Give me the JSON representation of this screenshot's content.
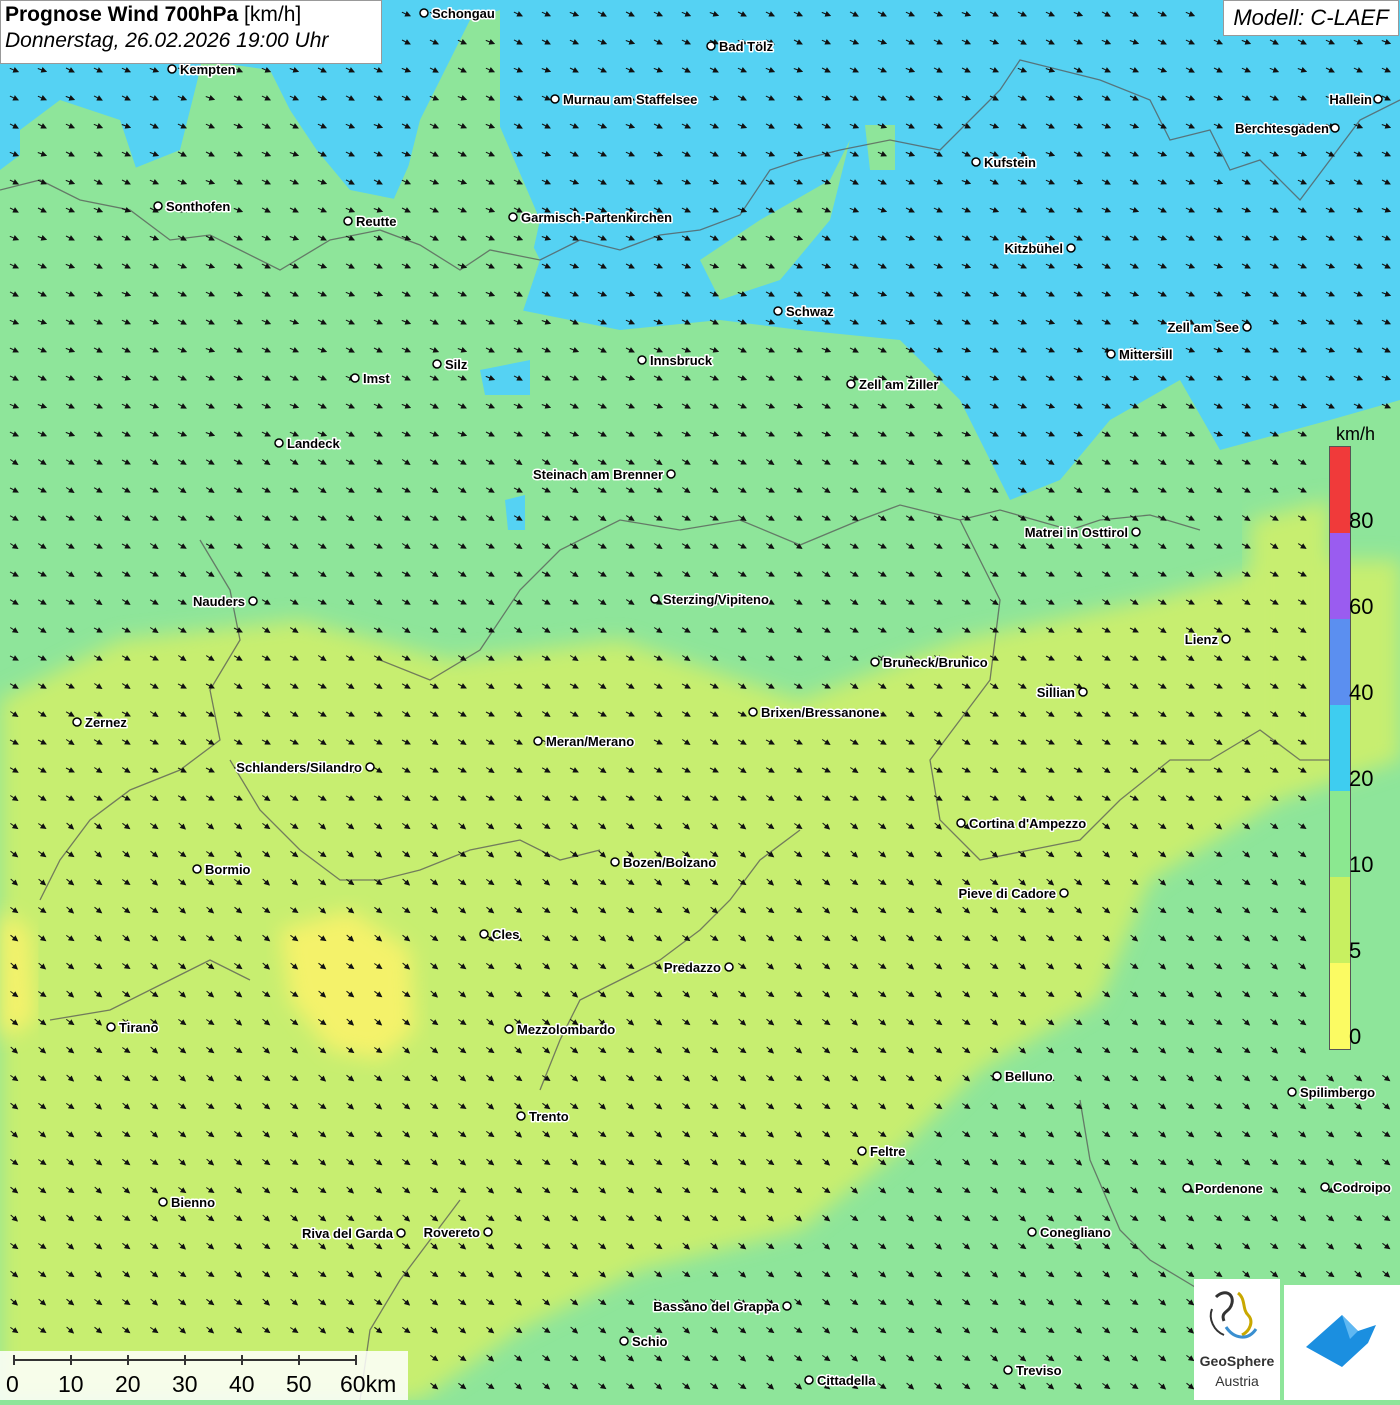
{
  "header": {
    "title_bold": "Prognose Wind 700hPa",
    "title_unit": "[km/h]",
    "date": "Donnerstag, 26.02.2026 19:00 Uhr"
  },
  "model": "Modell: C-LAEF",
  "legend": {
    "unit": "km/h",
    "labels": [
      "0",
      "5",
      "10",
      "20",
      "40",
      "60",
      "80"
    ],
    "colors": [
      "#fbfb63",
      "#c8f060",
      "#8be890",
      "#3ecdf0",
      "#5b8ff0",
      "#9a5cf0",
      "#f03a3a"
    ]
  },
  "scale": {
    "labels": [
      "0",
      "10",
      "20",
      "30",
      "40",
      "50",
      "60km"
    ]
  },
  "logos": {
    "geosphere_line1": "GeoSphere",
    "geosphere_line2": "Austria"
  },
  "cities": [
    {
      "name": "Schongau"
    },
    {
      "name": "Bad Tölz"
    },
    {
      "name": "Kempten"
    },
    {
      "name": "Murnau am Staffelsee"
    },
    {
      "name": "Hallein"
    },
    {
      "name": "Berchtesgaden"
    },
    {
      "name": "Kufstein"
    },
    {
      "name": "Sonthofen"
    },
    {
      "name": "Reutte"
    },
    {
      "name": "Garmisch-Partenkirchen"
    },
    {
      "name": "Kitzbühel"
    },
    {
      "name": "Schwaz"
    },
    {
      "name": "Zell am See"
    },
    {
      "name": "Mittersill"
    },
    {
      "name": "Innsbruck"
    },
    {
      "name": "Silz"
    },
    {
      "name": "Imst"
    },
    {
      "name": "Zell am Ziller"
    },
    {
      "name": "Landeck"
    },
    {
      "name": "Steinach am Brenner"
    },
    {
      "name": "Matrei in Osttirol"
    },
    {
      "name": "Nauders"
    },
    {
      "name": "Sterzing/Vipiteno"
    },
    {
      "name": "Lienz"
    },
    {
      "name": "Bruneck/Brunico"
    },
    {
      "name": "Sillian"
    },
    {
      "name": "Brixen/Bressanone"
    },
    {
      "name": "Zernez"
    },
    {
      "name": "Meran/Merano"
    },
    {
      "name": "Schlanders/Silandro"
    },
    {
      "name": "Cortina d'Ampezzo"
    },
    {
      "name": "Bozen/Bolzano"
    },
    {
      "name": "Bormio"
    },
    {
      "name": "Pieve di Cadore"
    },
    {
      "name": "Cles"
    },
    {
      "name": "Predazzo"
    },
    {
      "name": "Tirano"
    },
    {
      "name": "Mezzolombardo"
    },
    {
      "name": "Belluno"
    },
    {
      "name": "Spilimbergo"
    },
    {
      "name": "Trento"
    },
    {
      "name": "Feltre"
    },
    {
      "name": "Pordenone"
    },
    {
      "name": "Codroipo"
    },
    {
      "name": "Bienno"
    },
    {
      "name": "Riva del Garda"
    },
    {
      "name": "Rovereto"
    },
    {
      "name": "Conegliano"
    },
    {
      "name": "Bassano del Grappa"
    },
    {
      "name": "Schio"
    },
    {
      "name": "Treviso"
    },
    {
      "name": "Cittadella"
    }
  ]
}
